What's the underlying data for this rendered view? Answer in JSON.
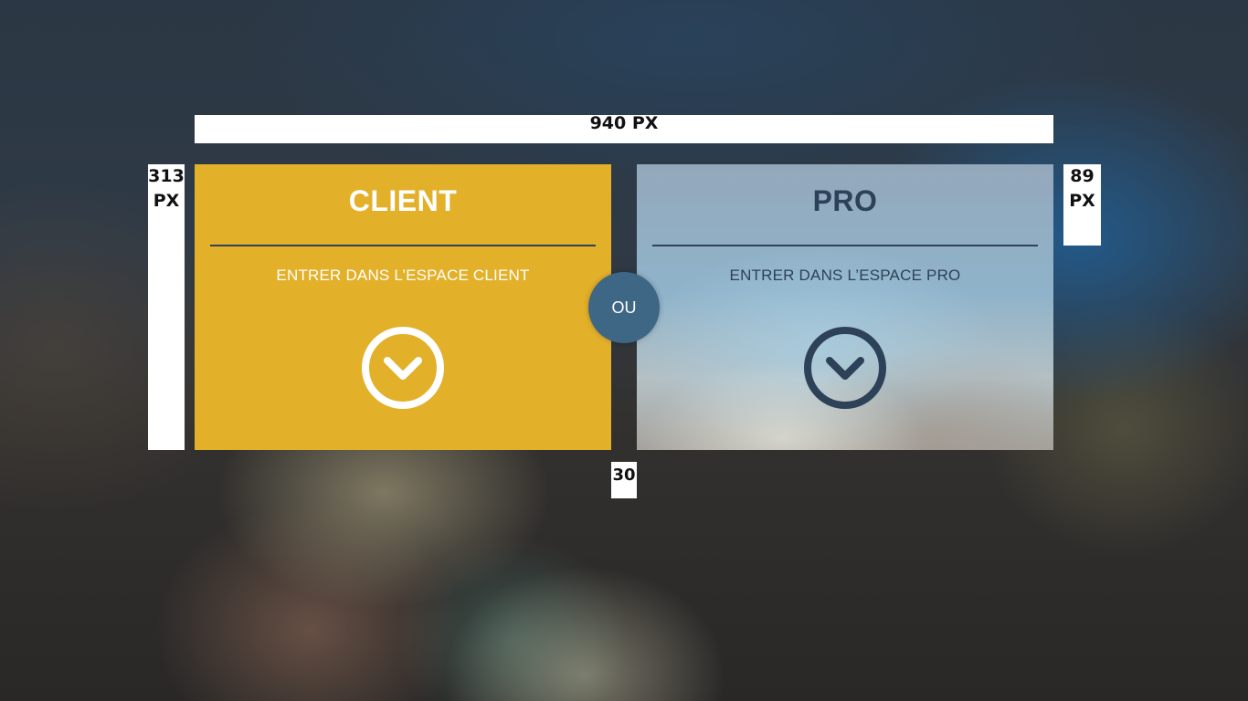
{
  "dimensions": {
    "width_label": "940 PX",
    "height_label_line1": "313",
    "height_label_line2": "PX",
    "divider_label_line1": "89",
    "divider_label_line2": "PX",
    "gap_label": "30"
  },
  "client_card": {
    "title": "CLIENT",
    "subtitle": "ENTRER DANS L’ESPACE CLIENT",
    "icon": "chevron-down-circle-icon",
    "bg_color": "#e3b02a",
    "text_color": "#ffffff"
  },
  "separator": {
    "label": "OU",
    "bg_color": "#3e6685"
  },
  "pro_card": {
    "title": "PRO",
    "subtitle": "ENTRER DANS L’ESPACE PRO",
    "icon": "chevron-down-circle-icon",
    "text_color": "#2d4158"
  }
}
